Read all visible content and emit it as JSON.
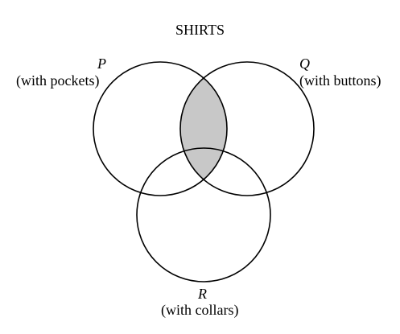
{
  "title": "SHIRTS",
  "sets": [
    {
      "id": "P",
      "name": "P",
      "description": "(with pockets)"
    },
    {
      "id": "Q",
      "name": "Q",
      "description": "(with buttons)"
    },
    {
      "id": "R",
      "name": "R",
      "description": "(with collars)"
    }
  ],
  "shaded_region": [
    "P",
    "Q"
  ],
  "colors": {
    "outline": "#000000",
    "shading": "#c8c8c8",
    "background": "#ffffff"
  }
}
